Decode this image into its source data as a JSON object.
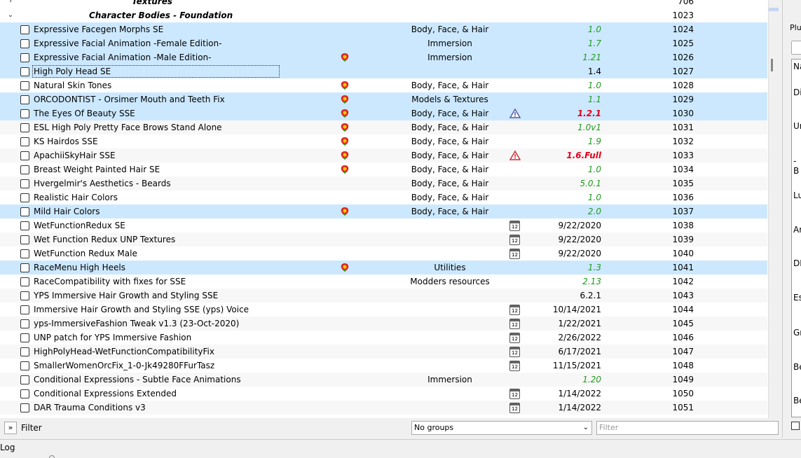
{
  "top_partial": {
    "name": "Textures",
    "priority": "706"
  },
  "separator": {
    "name": "Character Bodies - Foundation",
    "priority": "1023"
  },
  "mods": [
    {
      "name": "Expressive Facegen Morphs SE",
      "category": "Body, Face, & Hair",
      "version": "1.0",
      "ver_style": "green",
      "priority": "1024",
      "flag": false,
      "icon": "",
      "selected": true
    },
    {
      "name": "Expressive Facial Animation -Female Edition-",
      "category": "Immersion",
      "version": "1.7",
      "ver_style": "green",
      "priority": "1025",
      "flag": false,
      "icon": "",
      "selected": true
    },
    {
      "name": "Expressive Facial Animation -Male Edition-",
      "category": "Immersion",
      "version": "1.21",
      "ver_style": "green",
      "priority": "1026",
      "flag": true,
      "icon": "",
      "selected": true
    },
    {
      "name": "High Poly Head SE",
      "category": "",
      "version": "1.4",
      "ver_style": "plain",
      "priority": "1027",
      "flag": false,
      "icon": "",
      "selected": true,
      "focus": true
    },
    {
      "name": "Natural Skin Tones",
      "category": "Body, Face, & Hair",
      "version": "1.0",
      "ver_style": "green",
      "priority": "1028",
      "flag": true,
      "icon": "",
      "selected": false
    },
    {
      "name": "ORCODONTIST - Orsimer Mouth and Teeth Fix",
      "category": "Models & Textures",
      "version": "1.1",
      "ver_style": "green",
      "priority": "1029",
      "flag": true,
      "icon": "",
      "selected": true
    },
    {
      "name": "The Eyes Of Beauty SSE",
      "category": "Body, Face, & Hair",
      "version": "1.2.1",
      "ver_style": "red",
      "priority": "1030",
      "flag": true,
      "icon": "warn-blue",
      "selected": true
    },
    {
      "name": "ESL High Poly Pretty Face Brows Stand Alone",
      "category": "Body, Face, & Hair",
      "version": "1.0v1",
      "ver_style": "green",
      "priority": "1031",
      "flag": true,
      "icon": "",
      "selected": false
    },
    {
      "name": "KS Hairdos SSE",
      "category": "Body, Face, & Hair",
      "version": "1.9",
      "ver_style": "green",
      "priority": "1032",
      "flag": true,
      "icon": "",
      "selected": false
    },
    {
      "name": "ApachiiSkyHair SSE",
      "category": "Body, Face, & Hair",
      "version": "1.6.Full",
      "ver_style": "red",
      "priority": "1033",
      "flag": true,
      "icon": "warn-red",
      "selected": false
    },
    {
      "name": "Breast Weight Painted Hair SE",
      "category": "Body, Face, & Hair",
      "version": "1.0",
      "ver_style": "green",
      "priority": "1034",
      "flag": true,
      "icon": "",
      "selected": false
    },
    {
      "name": "Hvergelmir's Aesthetics - Beards",
      "category": "Body, Face, & Hair",
      "version": "5.0.1",
      "ver_style": "green",
      "priority": "1035",
      "flag": false,
      "icon": "",
      "selected": false
    },
    {
      "name": "Realistic Hair Colors",
      "category": "Body, Face, & Hair",
      "version": "1.0",
      "ver_style": "green",
      "priority": "1036",
      "flag": false,
      "icon": "",
      "selected": false
    },
    {
      "name": "Mild Hair Colors",
      "category": "Body, Face, & Hair",
      "version": "2.0",
      "ver_style": "green",
      "priority": "1037",
      "flag": true,
      "icon": "",
      "selected": true
    },
    {
      "name": "WetFunctionRedux SE",
      "category": "",
      "version": "9/22/2020",
      "ver_style": "plain",
      "priority": "1038",
      "flag": false,
      "icon": "calendar",
      "selected": false
    },
    {
      "name": "Wet Function Redux UNP Textures",
      "category": "",
      "version": "9/22/2020",
      "ver_style": "plain",
      "priority": "1039",
      "flag": false,
      "icon": "calendar",
      "selected": false
    },
    {
      "name": "WetFunction Redux Male",
      "category": "",
      "version": "9/22/2020",
      "ver_style": "plain",
      "priority": "1040",
      "flag": false,
      "icon": "calendar",
      "selected": false
    },
    {
      "name": "RaceMenu High Heels",
      "category": "Utilities",
      "version": "1.3",
      "ver_style": "green",
      "priority": "1041",
      "flag": true,
      "icon": "",
      "selected": true
    },
    {
      "name": "RaceCompatibility with fixes for SSE",
      "category": "Modders resources",
      "version": "2.13",
      "ver_style": "green",
      "priority": "1042",
      "flag": false,
      "icon": "",
      "selected": false
    },
    {
      "name": "YPS Immersive Hair Growth and Styling SSE",
      "category": "",
      "version": "6.2.1",
      "ver_style": "plain",
      "priority": "1043",
      "flag": false,
      "icon": "",
      "selected": false
    },
    {
      "name": "Immersive Hair Growth and Styling SSE (yps) Voice",
      "category": "",
      "version": "10/14/2021",
      "ver_style": "plain",
      "priority": "1044",
      "flag": false,
      "icon": "calendar",
      "selected": false
    },
    {
      "name": "yps-ImmersiveFashion Tweak v1.3 (23-Oct-2020)",
      "category": "",
      "version": "1/22/2021",
      "ver_style": "plain",
      "priority": "1045",
      "flag": false,
      "icon": "calendar",
      "selected": false
    },
    {
      "name": "UNP patch for YPS Immersive Fashion",
      "category": "",
      "version": "2/26/2022",
      "ver_style": "plain",
      "priority": "1046",
      "flag": false,
      "icon": "calendar",
      "selected": false
    },
    {
      "name": "HighPolyHead-WetFunctionCompatibilityFix",
      "category": "",
      "version": "6/17/2021",
      "ver_style": "plain",
      "priority": "1047",
      "flag": false,
      "icon": "calendar",
      "selected": false
    },
    {
      "name": "SmallerWomenOrcFix_1-0-Jk49280FFurTasz",
      "category": "",
      "version": "11/15/2021",
      "ver_style": "plain",
      "priority": "1048",
      "flag": false,
      "icon": "calendar",
      "selected": false
    },
    {
      "name": "Conditional Expressions - Subtle Face Animations",
      "category": "Immersion",
      "version": "1.20",
      "ver_style": "green",
      "priority": "1049",
      "flag": false,
      "icon": "",
      "selected": false
    },
    {
      "name": "Conditional Expressions Extended",
      "category": "",
      "version": "1/14/2022",
      "ver_style": "plain",
      "priority": "1050",
      "flag": false,
      "icon": "calendar",
      "selected": false
    },
    {
      "name": "DAR Trauma Conditions v3",
      "category": "",
      "version": "1/14/2022",
      "ver_style": "plain",
      "priority": "1051",
      "flag": false,
      "icon": "calendar",
      "selected": false
    }
  ],
  "calendar_glyph": "12",
  "filter_bar": {
    "expand_label": "»",
    "filter_label": "Filter",
    "groups_value": "No groups",
    "filter_placeholder": "Filter"
  },
  "right_panel": {
    "tab_label": "Plu",
    "labels": [
      "Na",
      "Di",
      "Ur",
      "-B",
      "Lu",
      "Ar",
      "DE",
      "Es",
      "Gr",
      "Be",
      "Be"
    ]
  },
  "log_label": "Log",
  "colors": {
    "selected_row": "#cce8ff",
    "version_green": "#1f9a1f",
    "version_red": "#e0001b"
  }
}
